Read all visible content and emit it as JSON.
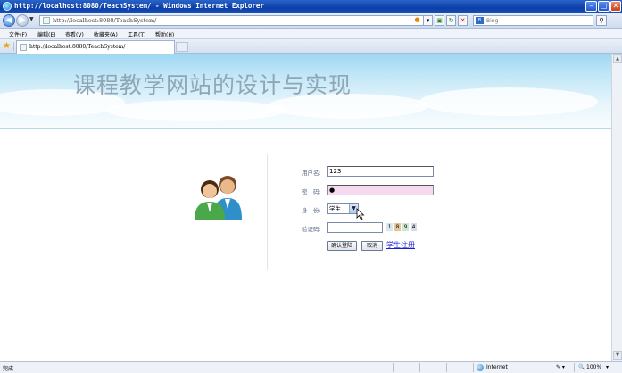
{
  "window": {
    "title": "http://localhost:8080/TeachSystem/ - Windows Internet Explorer",
    "minimize": "–",
    "maximize": "□",
    "close": "✕"
  },
  "address_bar": {
    "url": "http://localhost:8080/TeachSystem/",
    "search_placeholder": "Bing",
    "back_icon": "back-arrow-icon",
    "forward_icon": "forward-arrow-icon"
  },
  "menu": {
    "items": [
      "文件(F)",
      "编辑(E)",
      "查看(V)",
      "收藏夹(A)",
      "工具(T)",
      "帮助(H)"
    ]
  },
  "tab": {
    "title": "http://localhost:8080/TeachSystem/"
  },
  "banner": {
    "title": "课程教学网站的设计与实现"
  },
  "login_form": {
    "username_label": "用户名:",
    "username_value": "123",
    "password_label": "密　码:",
    "password_value": "●",
    "role_label": "身　份:",
    "role_selected": "学生",
    "captcha_label": "验证码:",
    "captcha_value": "",
    "captcha_digits": [
      "1",
      "8",
      "9",
      "4"
    ],
    "captcha_colors": [
      "#d7e7ef",
      "#e8c39a",
      "#cfe6cf",
      "#d6dbe8"
    ],
    "login_button": "确认登陆",
    "cancel_button": "取消",
    "register_link": "学生注册"
  },
  "status_bar": {
    "status": "完成",
    "zone": "Internet",
    "zoom": "100%"
  }
}
